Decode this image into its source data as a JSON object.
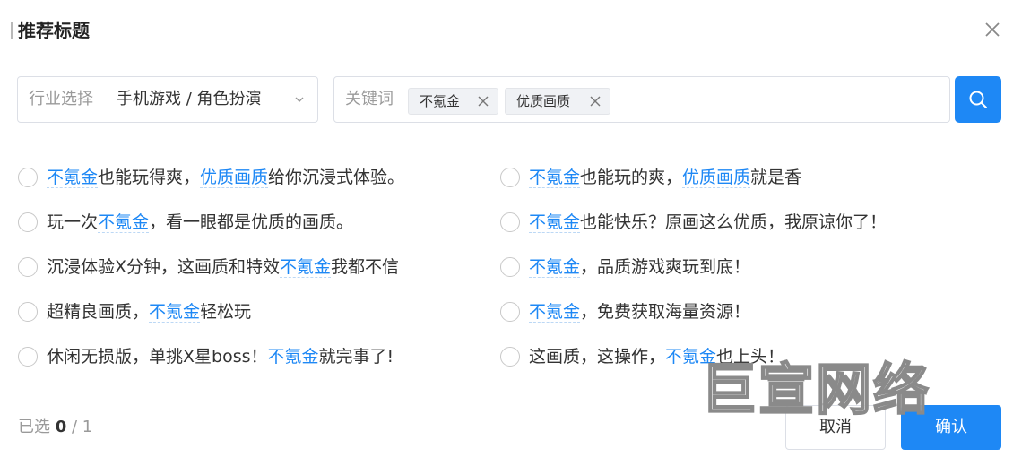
{
  "dialog": {
    "title": "推荐标题"
  },
  "filters": {
    "industry_label": "行业选择",
    "industry_value": "手机游戏 / 角色扮演",
    "keyword_label": "关键词",
    "tags": [
      "不氪金",
      "优质画质"
    ]
  },
  "options": [
    {
      "col": 0,
      "row": 0,
      "parts": [
        {
          "t": "不氪金",
          "hl": true
        },
        {
          "t": "也能玩得爽，",
          "hl": false
        },
        {
          "t": "优质画质",
          "hl": true
        },
        {
          "t": "给你沉浸式体验。",
          "hl": false
        }
      ]
    },
    {
      "col": 1,
      "row": 0,
      "parts": [
        {
          "t": "不氪金",
          "hl": true
        },
        {
          "t": "也能玩的爽，",
          "hl": false
        },
        {
          "t": "优质画质",
          "hl": true
        },
        {
          "t": "就是香",
          "hl": false
        }
      ]
    },
    {
      "col": 0,
      "row": 1,
      "parts": [
        {
          "t": "玩一次",
          "hl": false
        },
        {
          "t": "不氪金",
          "hl": true
        },
        {
          "t": "，看一眼都是优质的画质。",
          "hl": false
        }
      ]
    },
    {
      "col": 1,
      "row": 1,
      "parts": [
        {
          "t": "不氪金",
          "hl": true
        },
        {
          "t": "也能快乐？原画这么优质，我原谅你了！",
          "hl": false
        }
      ]
    },
    {
      "col": 0,
      "row": 2,
      "parts": [
        {
          "t": "沉浸体验X分钟，这画质和特效",
          "hl": false
        },
        {
          "t": "不氪金",
          "hl": true
        },
        {
          "t": "我都不信",
          "hl": false
        }
      ]
    },
    {
      "col": 1,
      "row": 2,
      "parts": [
        {
          "t": "不氪金",
          "hl": true
        },
        {
          "t": "，品质游戏爽玩到底！",
          "hl": false
        }
      ]
    },
    {
      "col": 0,
      "row": 3,
      "parts": [
        {
          "t": "超精良画质，",
          "hl": false
        },
        {
          "t": "不氪金",
          "hl": true
        },
        {
          "t": "轻松玩",
          "hl": false
        }
      ]
    },
    {
      "col": 1,
      "row": 3,
      "parts": [
        {
          "t": "不氪金",
          "hl": true
        },
        {
          "t": "，免费获取海量资源！",
          "hl": false
        }
      ]
    },
    {
      "col": 0,
      "row": 4,
      "parts": [
        {
          "t": "休闲无损版，单挑X星boss！",
          "hl": false
        },
        {
          "t": "不氪金",
          "hl": true
        },
        {
          "t": "就完事了!",
          "hl": false
        }
      ]
    },
    {
      "col": 1,
      "row": 4,
      "parts": [
        {
          "t": "这画质，这操作，",
          "hl": false
        },
        {
          "t": "不氪金",
          "hl": true
        },
        {
          "t": "也上头！",
          "hl": false
        }
      ]
    }
  ],
  "footer": {
    "selected_prefix": "已选",
    "selected_count": "0",
    "selected_total": "/ 1",
    "cancel_label": "取消",
    "confirm_label": "确认"
  },
  "watermark": {
    "text": "巨宣网络"
  },
  "colors": {
    "accent": "#1e88f5",
    "border": "#dcdfe6",
    "muted": "#9a9a9a"
  },
  "icons": {
    "close": "close-icon",
    "dropdown": "chevron-down-icon",
    "tag_remove": "close-icon",
    "search": "search-icon"
  }
}
